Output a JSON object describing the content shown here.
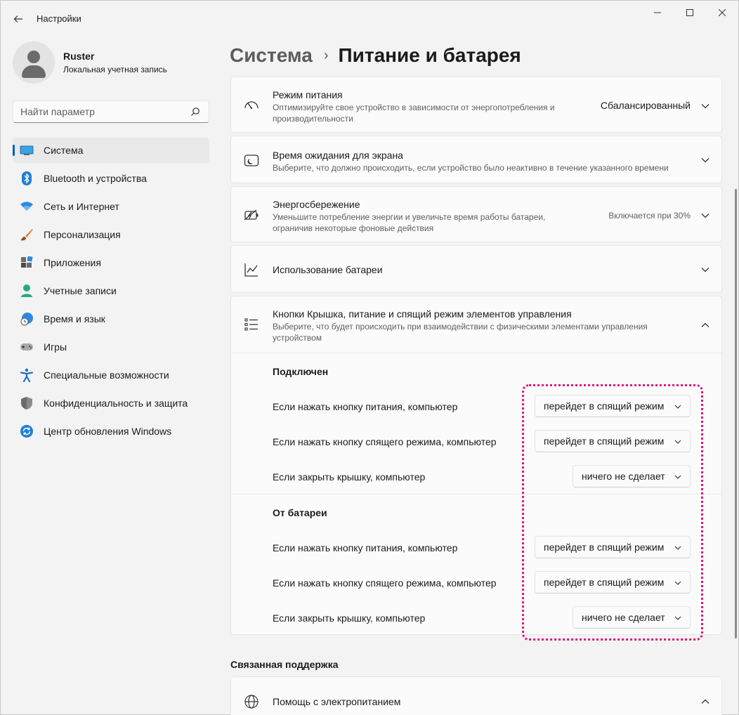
{
  "window": {
    "title": "Настройки",
    "controls": [
      "minimize",
      "maximize",
      "close"
    ]
  },
  "profile": {
    "name": "Ruster",
    "account_type": "Локальная учетная запись"
  },
  "search": {
    "placeholder": "Найти параметр"
  },
  "sidebar": {
    "items": [
      {
        "label": "Система",
        "icon": "system-icon",
        "active": true
      },
      {
        "label": "Bluetooth и устройства",
        "icon": "bluetooth-icon"
      },
      {
        "label": "Сеть и Интернет",
        "icon": "wifi-icon"
      },
      {
        "label": "Персонализация",
        "icon": "brush-icon"
      },
      {
        "label": "Приложения",
        "icon": "apps-icon"
      },
      {
        "label": "Учетные записи",
        "icon": "accounts-icon"
      },
      {
        "label": "Время и язык",
        "icon": "time-language-icon"
      },
      {
        "label": "Игры",
        "icon": "gamepad-icon"
      },
      {
        "label": "Специальные возможности",
        "icon": "accessibility-icon"
      },
      {
        "label": "Конфиденциальность и защита",
        "icon": "shield-icon"
      },
      {
        "label": "Центр обновления Windows",
        "icon": "update-icon"
      }
    ]
  },
  "breadcrumb": {
    "parent": "Система",
    "separator": "›",
    "current": "Питание и батарея"
  },
  "power_mode": {
    "title": "Режим питания",
    "desc": "Оптимизируйте свое устройство в зависимости от энергопотребления и производительности",
    "value": "Сбалансированный"
  },
  "screen_timeout": {
    "title": "Время ожидания для экрана",
    "desc": "Выберите, что должно происходить, если устройство было неактивно в течение указанного времени"
  },
  "battery_saver": {
    "title": "Энергосбережение",
    "desc": "Уменьшите потребление энергии и увеличьте время работы батареи, ограничив некоторые фоновые действия",
    "value": "Включается при 30%"
  },
  "battery_usage": {
    "title": "Использование батареи"
  },
  "lid_buttons": {
    "title": "Кнопки Крышка, питание и спящий режим элементов управления",
    "desc": "Выберите, что будет происходить при взаимодействии с физическими элементами управления устройством",
    "plugged_in": {
      "heading": "Подключен",
      "rows": [
        {
          "label": "Если нажать кнопку питания, компьютер",
          "value": "перейдет в спящий режим"
        },
        {
          "label": "Если нажать кнопку спящего режима, компьютер",
          "value": "перейдет в спящий режим"
        },
        {
          "label": "Если закрыть крышку, компьютер",
          "value": "ничего не сделает"
        }
      ]
    },
    "on_battery": {
      "heading": "От батареи",
      "rows": [
        {
          "label": "Если нажать кнопку питания, компьютер",
          "value": "перейдет в спящий режим"
        },
        {
          "label": "Если нажать кнопку спящего режима, компьютер",
          "value": "перейдет в спящий режим"
        },
        {
          "label": "Если закрыть крышку, компьютер",
          "value": "ничего не сделает"
        }
      ]
    }
  },
  "related": {
    "title": "Связанная поддержка",
    "help_power": "Помощь с электропитанием"
  },
  "colors": {
    "accent": "#005fb8",
    "highlight": "#e0157a"
  }
}
